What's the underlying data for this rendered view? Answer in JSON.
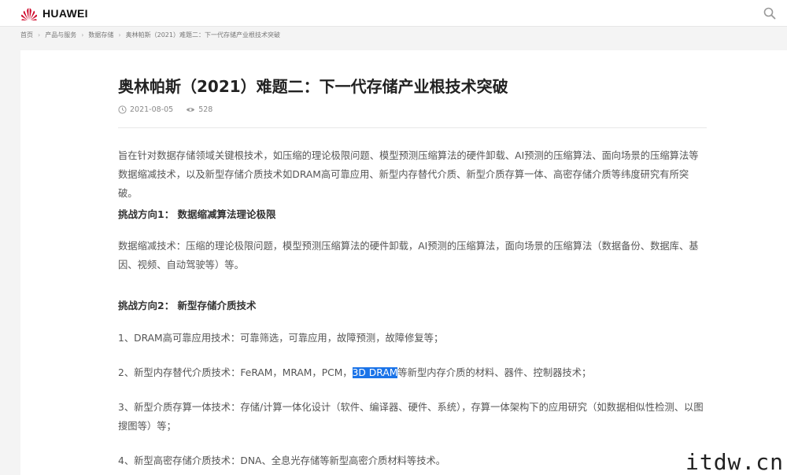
{
  "header": {
    "brand": "HUAWEI",
    "brand_color": "#cf0a2c",
    "logo_icon": "huawei-petal-icon",
    "search_icon": "search-icon"
  },
  "breadcrumb": {
    "items": [
      "首页",
      "产品与服务",
      "数据存储",
      "奥林帕斯（2021）难题二：下一代存储产业根技术突破"
    ],
    "separator_icon": "chevron-right-icon"
  },
  "article": {
    "title": "奥林帕斯（2021）难题二：下一代存储产业根技术突破",
    "date": "2021-08-05",
    "views": "528",
    "intro": "旨在针对数据存储领域关键根技术，如压缩的理论极限问题、模型预测压缩算法的硬件卸载、AI预测的压缩算法、面向场景的压缩算法等数据缩减技术，以及新型存储介质技术如DRAM高可靠应用、新型内存替代介质、新型介质存算一体、高密存储介质等纬度研究有所突破。",
    "section1": {
      "heading": "挑战方向1：  数据缩减算法理论极限",
      "body": "数据缩减技术：压缩的理论极限问题，模型预测压缩算法的硬件卸载，AI预测的压缩算法，面向场景的压缩算法（数据备份、数据库、基因、视频、自动驾驶等）等。"
    },
    "section2": {
      "heading": "挑战方向2：  新型存储介质技术",
      "item1": "1、DRAM高可靠应用技术：可靠筛选，可靠应用，故障预测，故障修复等；",
      "item2_before": "2、新型内存替代介质技术：FeRAM，MRAM，PCM，",
      "item2_highlight": "3D DRAM",
      "item2_after": "等新型内存介质的材料、器件、控制器技术；",
      "item3": "3、新型介质存算一体技术：存储/计算一体化设计（软件、编译器、硬件、系统），存算一体架构下的应用研究（如数据相似性检测、以图搜图等）等；",
      "item4": "4、新型高密存储介质技术：DNA、全息光存储等新型高密介质材料等技术。"
    }
  },
  "watermark": "itdw.cn",
  "colors": {
    "highlight": "#1a73e8",
    "background": "#f4f4f4"
  }
}
